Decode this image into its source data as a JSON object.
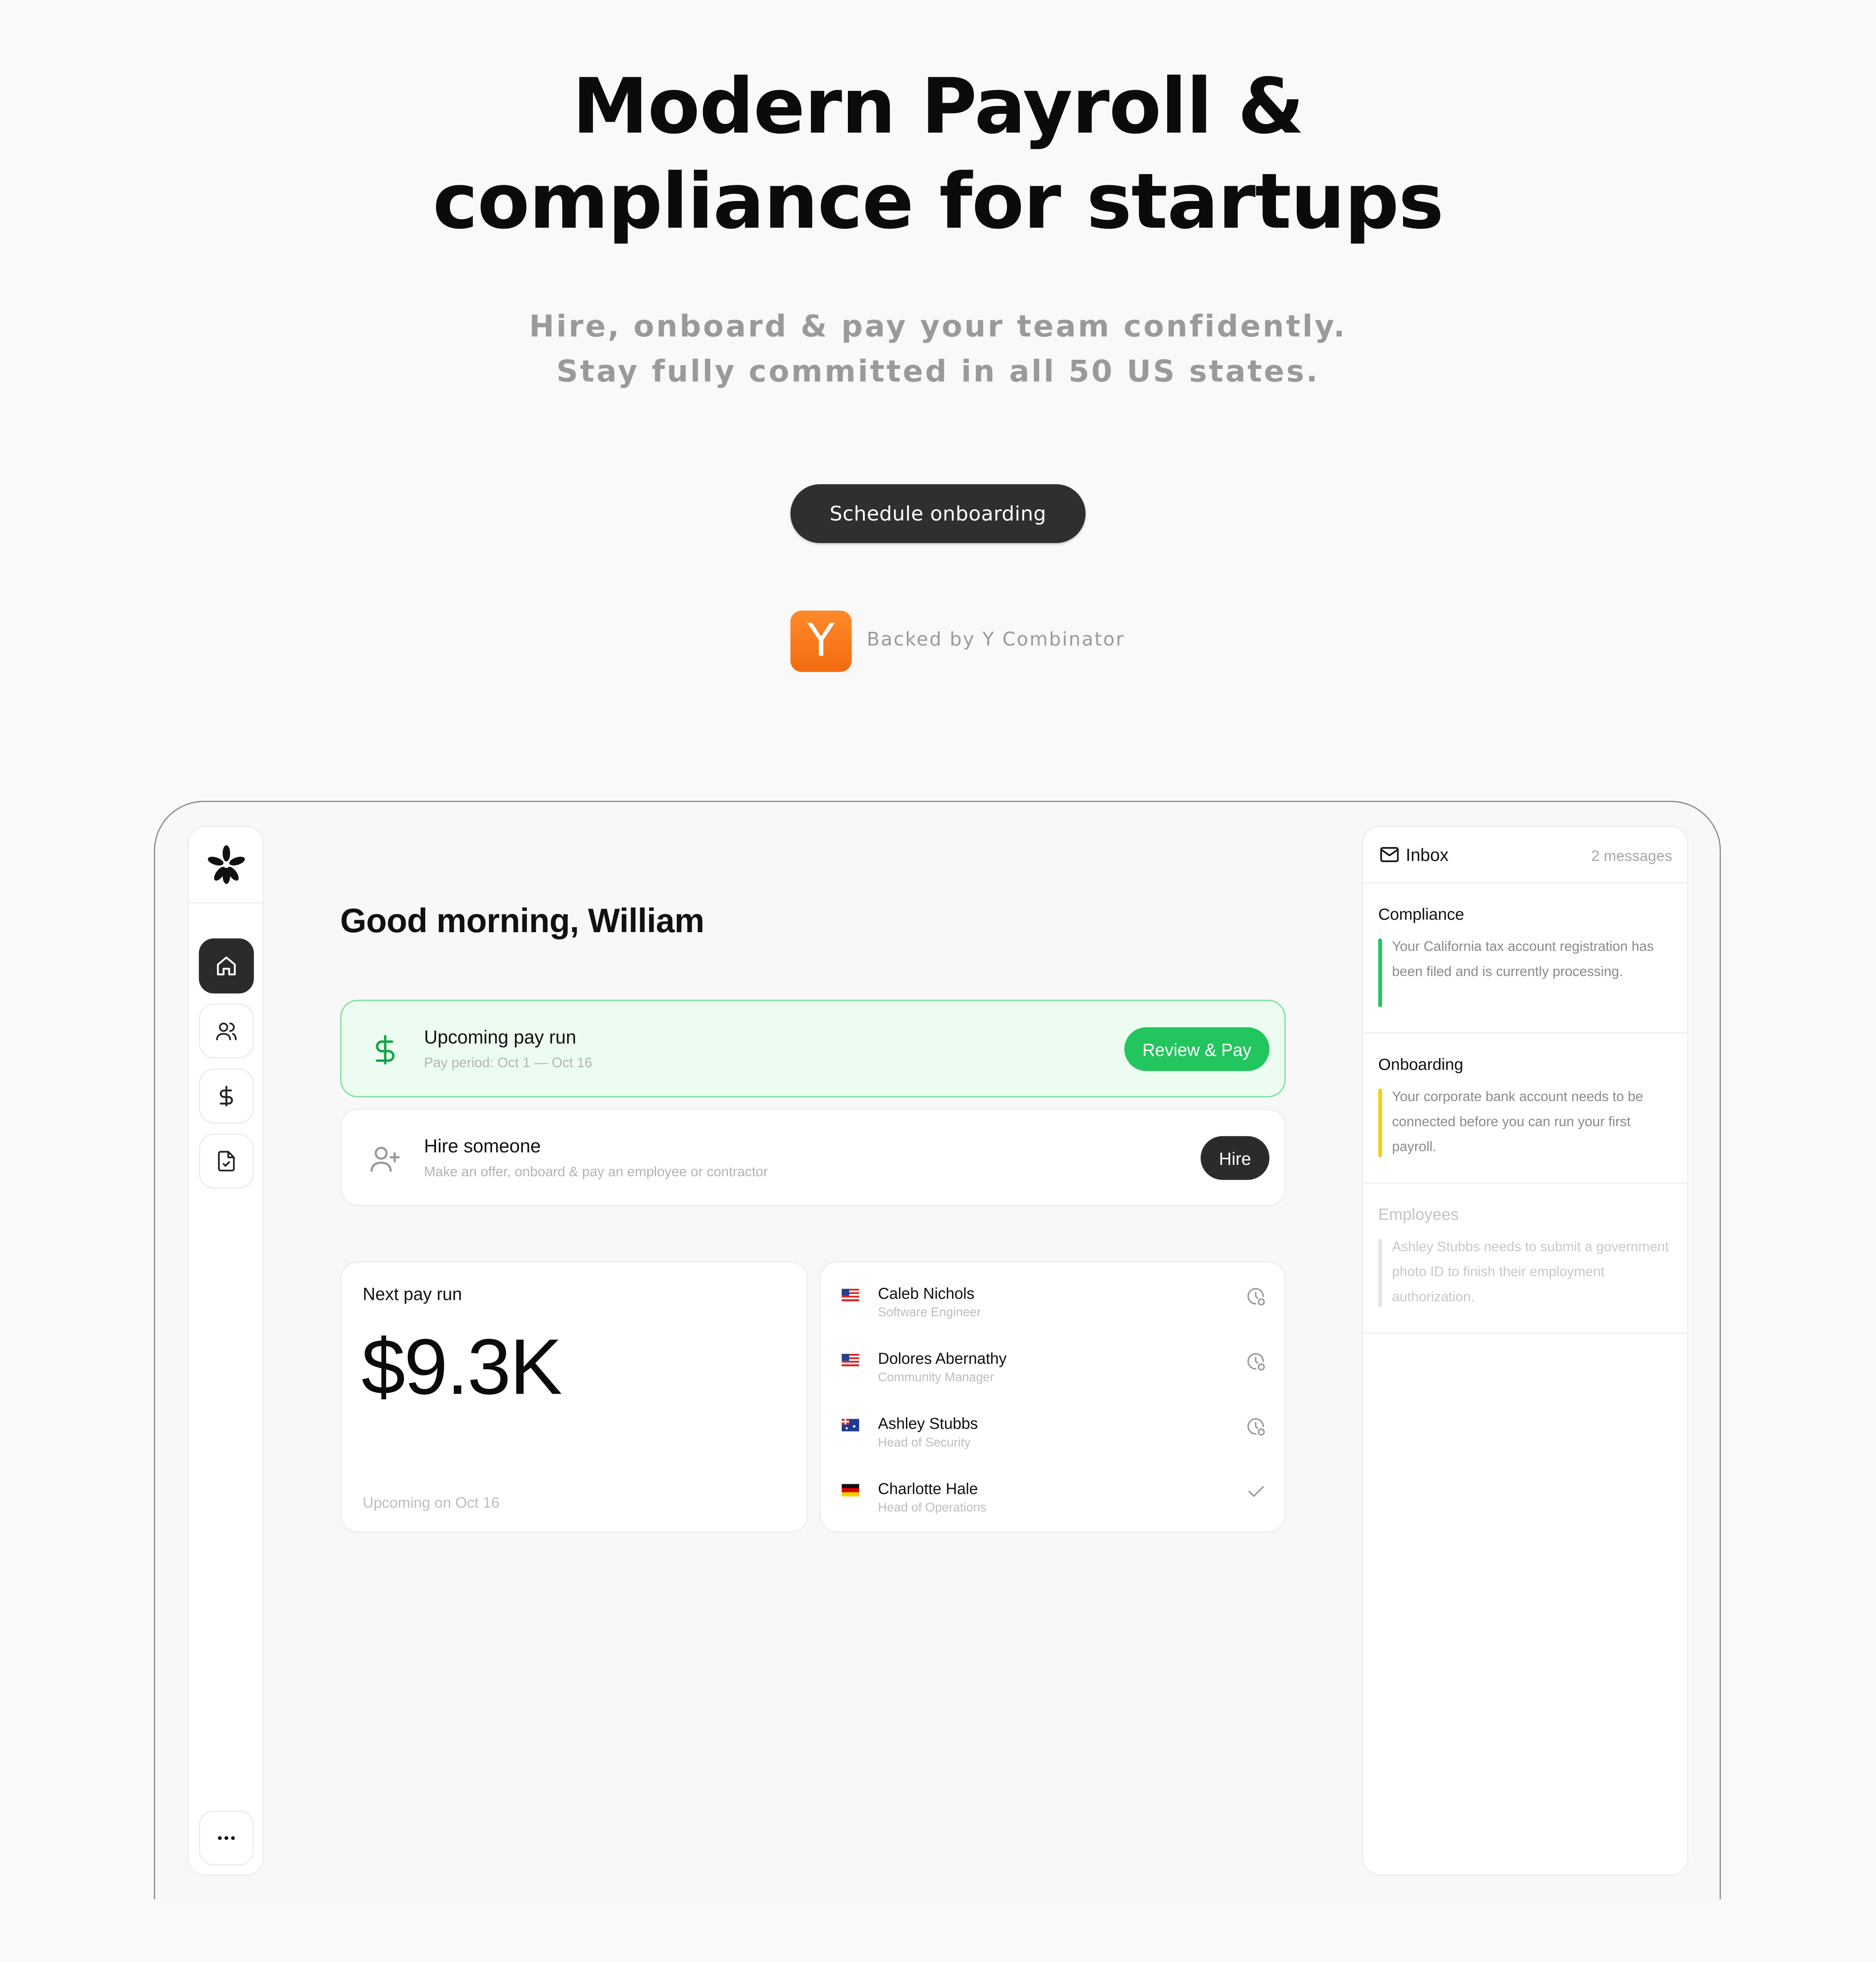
{
  "hero": {
    "title_line1": "Modern Payroll &",
    "title_line2": "compliance for startups",
    "subtitle_line1": "Hire, onboard & pay your team confidently.",
    "subtitle_line2": "Stay fully committed in all 50 US states.",
    "cta_label": "Schedule onboarding",
    "backed_logo": "Y",
    "backed_text": "Backed by Y Combinator"
  },
  "colors": {
    "accent_green": "#22c55e",
    "dark": "#2b2b2b",
    "yc_orange": "#f26b0f",
    "compliance_bar": "#22c55e",
    "onboarding_bar": "#facc15",
    "employees_bar": "#e5e5e5"
  },
  "sidebar": {
    "logo_icon": "asterisk-logo-icon",
    "items": [
      {
        "icon": "home-icon",
        "active": true
      },
      {
        "icon": "people-icon",
        "active": false
      },
      {
        "icon": "dollar-icon",
        "active": false
      },
      {
        "icon": "document-check-icon",
        "active": false
      }
    ],
    "more_icon": "more-icon"
  },
  "main": {
    "greeting": "Good morning, William",
    "pay_run": {
      "title": "Upcoming pay run",
      "subtitle": "Pay period: Oct 1 — Oct 16",
      "button": "Review & Pay"
    },
    "hire": {
      "title": "Hire someone",
      "subtitle": "Make an offer, onboard & pay an employee or contractor",
      "button": "Hire"
    },
    "next_pay_run": {
      "label": "Next pay run",
      "amount": "$9.3K",
      "date": "Upcoming on Oct 16"
    },
    "employees": [
      {
        "name": "Caleb Nichols",
        "role": "Software Engineer",
        "flag": "us",
        "status": "pending"
      },
      {
        "name": "Dolores Abernathy",
        "role": "Community Manager",
        "flag": "us",
        "status": "pending"
      },
      {
        "name": "Ashley Stubbs",
        "role": "Head of Security",
        "flag": "au",
        "status": "pending"
      },
      {
        "name": "Charlotte Hale",
        "role": "Head of Operations",
        "flag": "de",
        "status": "done"
      }
    ]
  },
  "inbox": {
    "title": "Inbox",
    "count": "2 messages",
    "messages": [
      {
        "title": "Compliance",
        "text": "Your California tax account registration has been filed and is currently processing."
      },
      {
        "title": "Onboarding",
        "text": "Your corporate bank account needs to be connected before you can run your first payroll."
      },
      {
        "title": "Employees",
        "text": "Ashley Stubbs needs to submit a government photo ID to finish their employment authorization."
      }
    ]
  }
}
